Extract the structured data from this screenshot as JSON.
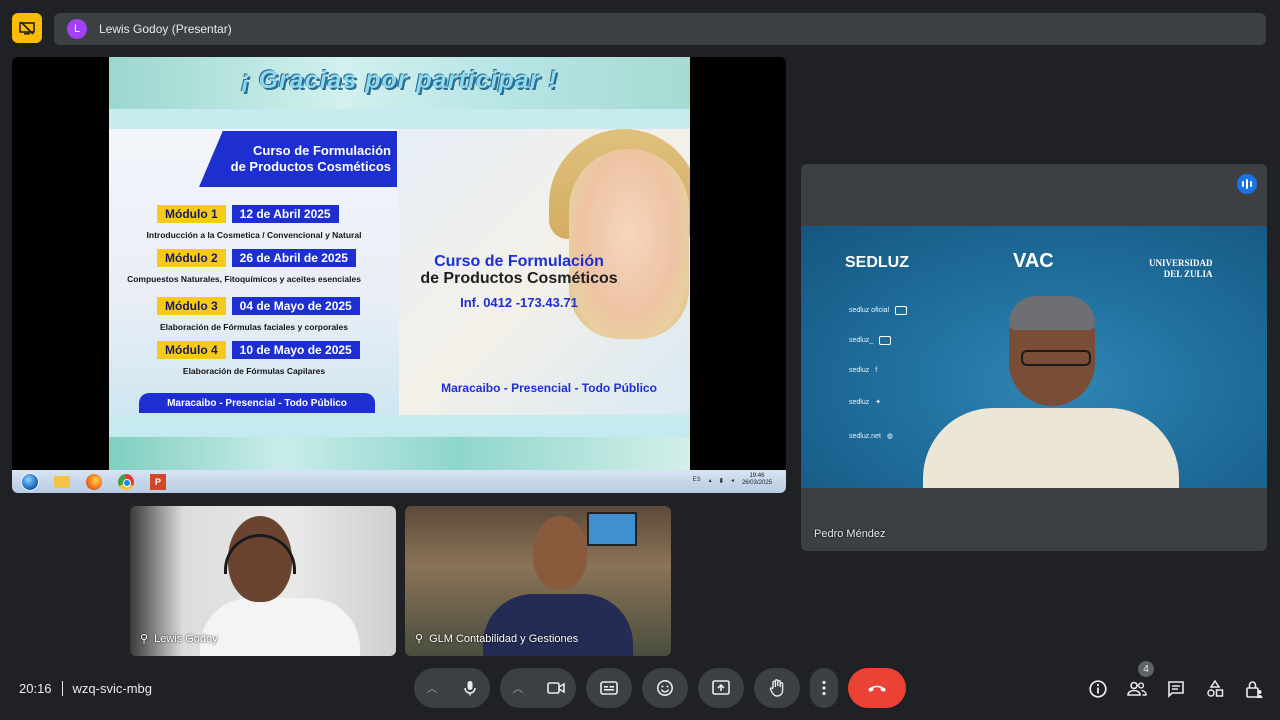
{
  "banner": {
    "avatar_letter": "L",
    "text": "Lewis Godoy (Presentar)"
  },
  "slide": {
    "title": "¡ Gracias por participar !",
    "course_header_line1": "Curso de Formulación",
    "course_header_line2": "de Productos Cosméticos",
    "modules": [
      {
        "label": "Módulo 1",
        "date": "12 de Abril 2025",
        "desc": "Introducción a la Cosmetica / Convencional y Natural"
      },
      {
        "label": "Módulo 2",
        "date": "26 de Abril de 2025",
        "desc": "Compuestos Naturales, Fitoquímicos y aceites esenciales"
      },
      {
        "label": "Módulo 3",
        "date": "04 de Mayo de 2025",
        "desc": "Elaboración de Fórmulas faciales y corporales"
      },
      {
        "label": "Módulo 4",
        "date": "10 de Mayo de 2025",
        "desc": "Elaboración de Fórmulas Capilares"
      }
    ],
    "left_footer": "Maracaibo - Presencial - Todo Público",
    "right_title_line1": "Curso de Formulación",
    "right_title_line2": "de Productos Cosméticos",
    "right_info": "Inf. 0412 -173.43.71",
    "right_footer": "Maracaibo - Presencial - Todo Público"
  },
  "taskbar": {
    "lang": "ES",
    "time": "19:46",
    "date": "26/03/2025",
    "powerpoint_label": "P"
  },
  "participants": {
    "pedro": {
      "name": "Pedro Méndez",
      "bg_logos": {
        "sedluz": "SEDLUZ",
        "vac": "VAC",
        "uni_line1": "UNIVERSIDAD",
        "uni_line2": "DEL ZULIA"
      },
      "socials": [
        "sedluz oficial",
        "sedluz_",
        "sedluz",
        "sedluz",
        "sedluz.net"
      ]
    },
    "lewis": {
      "name": "Lewis Godoy"
    },
    "glm": {
      "name": "GLM Contabilidad y Gestiones"
    }
  },
  "meeting": {
    "time": "20:16",
    "code": "wzq-svic-mbg",
    "participant_count": "4"
  },
  "colors": {
    "background": "#202124",
    "surface": "#3c4043",
    "accent_blue": "#1a73e8",
    "end_call_red": "#ea4335",
    "present_yellow": "#fbbc04"
  }
}
